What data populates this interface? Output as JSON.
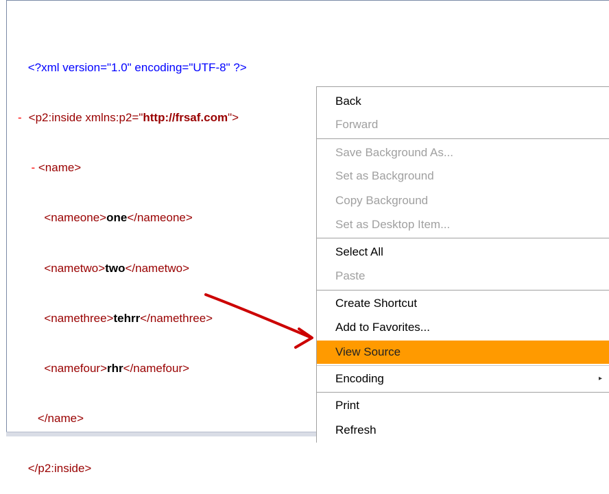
{
  "xml": {
    "line1": "<?xml version=\"1.0\" encoding=\"UTF-8\" ?>",
    "line2_minus": "-",
    "line2_open": "<p2:inside xmlns:p2=\"",
    "line2_url": "http://frsaf.com",
    "line2_close": "\">",
    "line3_minus": "-",
    "line3": "<name>",
    "nameone_open": "<nameone>",
    "nameone_val": "one",
    "nameone_close": "</nameone>",
    "nametwo_open": "<nametwo>",
    "nametwo_val": "two",
    "nametwo_close": "</nametwo>",
    "namethree_open": "<namethree>",
    "namethree_val": "tehrr",
    "namethree_close": "</namethree>",
    "namefour_open": "<namefour>",
    "namefour_val": "rhr",
    "namefour_close": "</namefour>",
    "name_close": "</name>",
    "inside_close": "</p2:inside>"
  },
  "menu": {
    "back": "Back",
    "forward": "Forward",
    "save_background": "Save Background As...",
    "set_background": "Set as Background",
    "copy_background": "Copy Background",
    "set_desktop": "Set as Desktop Item...",
    "select_all": "Select All",
    "paste": "Paste",
    "create_shortcut": "Create Shortcut",
    "add_favorites": "Add to Favorites...",
    "view_source": "View Source",
    "encoding": "Encoding",
    "print": "Print",
    "refresh": "Refresh"
  },
  "colors": {
    "highlight": "#ff9a00",
    "arrow": "#cc0000"
  }
}
